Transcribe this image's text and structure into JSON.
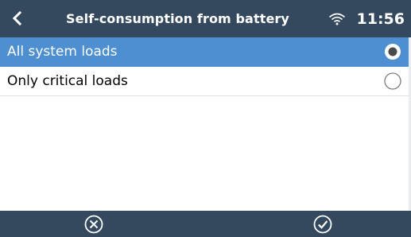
{
  "header": {
    "title": "Self-consumption from battery",
    "time": "11:56",
    "back_icon": "chevron-left-icon",
    "signal_icon": "wifi-icon"
  },
  "options": [
    {
      "label": "All system loads",
      "selected": true
    },
    {
      "label": "Only critical loads",
      "selected": false
    }
  ],
  "footer": {
    "cancel_icon": "circled-x-icon",
    "confirm_icon": "circled-check-icon"
  },
  "colors": {
    "header_bg": "#34495e",
    "selection_bg": "#4e8fd2",
    "text": "#000000",
    "radio_stroke": "#7a7a7a"
  }
}
